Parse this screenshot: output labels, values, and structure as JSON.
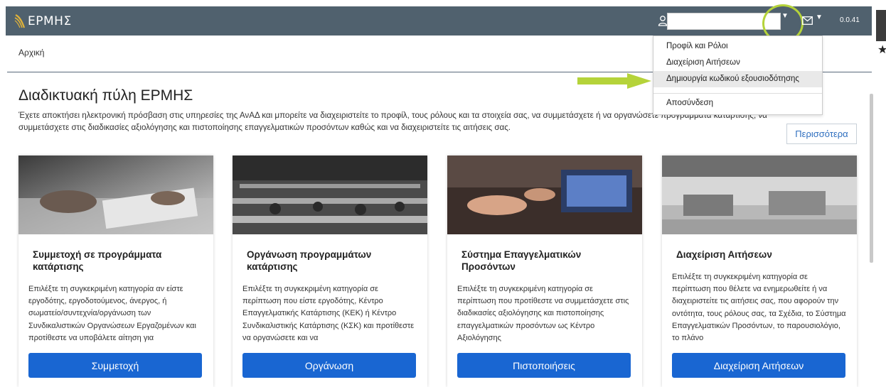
{
  "header": {
    "logo_text": "ΕΡΜΗΣ",
    "user_field_value": "",
    "version": "0.0.41"
  },
  "breadcrumb": {
    "home": "Αρχική"
  },
  "user_menu": {
    "items": [
      {
        "label": "Προφίλ και Ρόλοι"
      },
      {
        "label": "Διαχείριση Αιτήσεων"
      },
      {
        "label": "Δημιουργία κωδικού εξουσιοδότησης"
      },
      {
        "label": "Αποσύνδεση"
      }
    ]
  },
  "main": {
    "title": "Διαδικτυακή πύλη ΕΡΜΗΣ",
    "intro_line1": "Έχετε αποκτήσει ηλεκτρονική πρόσβαση στις υπηρεσίες της ΑνΑΔ και μπορείτε να διαχειριστείτε το προφίλ, τους ρόλους και τα στοιχεία σας, να συμμετάσχετε ή να οργανώσετε προγράμματα κατάρτισης, να",
    "intro_line2": "συμμετάσχετε στις διαδικασίες αξιολόγησης και πιστοποίησης επαγγελματικών προσόντων καθώς και να διαχειριστείτε τις αιτήσεις σας.",
    "more_button": "Περισσότερα"
  },
  "cards": [
    {
      "title": "Συμμετοχή σε προγράμματα κατάρτισης",
      "description": "Επιλέξτε τη συγκεκριμένη κατηγορία αν είστε εργοδότης, εργοδοτούμενος, άνεργος, ή σωματείο/συντεχνία/οργάνωση των Συνδικαλιστικών Οργανώσεων Εργαζομένων και προτίθεστε να υποβάλετε αίτηση για",
      "button": "Συμμετοχή"
    },
    {
      "title": "Οργάνωση προγραμμάτων κατάρτισης",
      "description": "Επιλέξτε τη συγκεκριμένη κατηγορία σε περίπτωση που είστε εργοδότης, Κέντρο Επαγγελματικής Κατάρτισης (ΚΕΚ) ή Κέντρο Συνδικαλιστικής Κατάρτισης (ΚΣΚ) και προτίθεστε να οργανώσετε και να",
      "button": "Οργάνωση"
    },
    {
      "title": "Σύστημα Επαγγελματικών Προσόντων",
      "description": "Επιλέξτε τη συγκεκριμένη κατηγορία σε περίπτωση που προτίθεστε να συμμετάσχετε στις διαδικασίες αξιολόγησης και πιστοποίησης επαγγελματικών προσόντων ως Κέντρο Αξιολόγησης",
      "button": "Πιστοποιήσεις"
    },
    {
      "title": "Διαχείριση Αιτήσεων",
      "description": "Επιλέξτε τη συγκεκριμένη κατηγορία σε περίπτωση που θέλετε να ενημερωθείτε ή να διαχειριστείτε τις αιτήσεις σας, που αφορούν την οντότητα, τους ρόλους σας, τα Σχέδια, το Σύστημα Επαγγελματικών Προσόντων, το παρουσιολόγιο, το πλάνο",
      "button": "Διαχείριση Αιτήσεων"
    }
  ],
  "colors": {
    "topbar": "#50616e",
    "primary_button": "#1966d2",
    "highlight": "#b5d33a",
    "link": "#2f6fbf"
  },
  "icons": [
    "hermes-logo-icon",
    "user-icon",
    "chevron-down-icon",
    "mail-icon",
    "star-icon",
    "arrow-annotation-icon"
  ]
}
